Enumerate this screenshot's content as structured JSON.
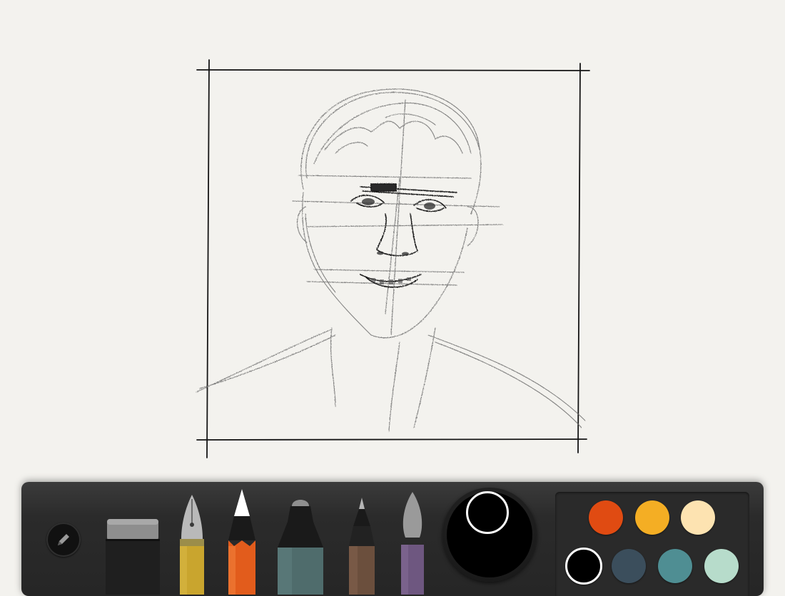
{
  "app": {
    "toolbar": {
      "menu_icon": "pencil-icon",
      "tools": [
        {
          "name": "eraser",
          "icon": "eraser-icon"
        },
        {
          "name": "fountain-pen",
          "icon": "fountain-pen-icon"
        },
        {
          "name": "pencil",
          "icon": "pencil-tool-icon",
          "active": true
        },
        {
          "name": "marker",
          "icon": "marker-icon"
        },
        {
          "name": "pen",
          "icon": "pen-icon"
        },
        {
          "name": "brush",
          "icon": "brush-icon"
        }
      ],
      "current_color": "#000000",
      "palette": [
        {
          "color": "#e04b12"
        },
        {
          "color": "#f4ae24"
        },
        {
          "color": "#fde3b1"
        },
        {
          "color": "#000000",
          "selected": true
        },
        {
          "color": "#3b4e5c"
        },
        {
          "color": "#4f8e93"
        },
        {
          "color": "#b7dccb"
        }
      ]
    }
  }
}
